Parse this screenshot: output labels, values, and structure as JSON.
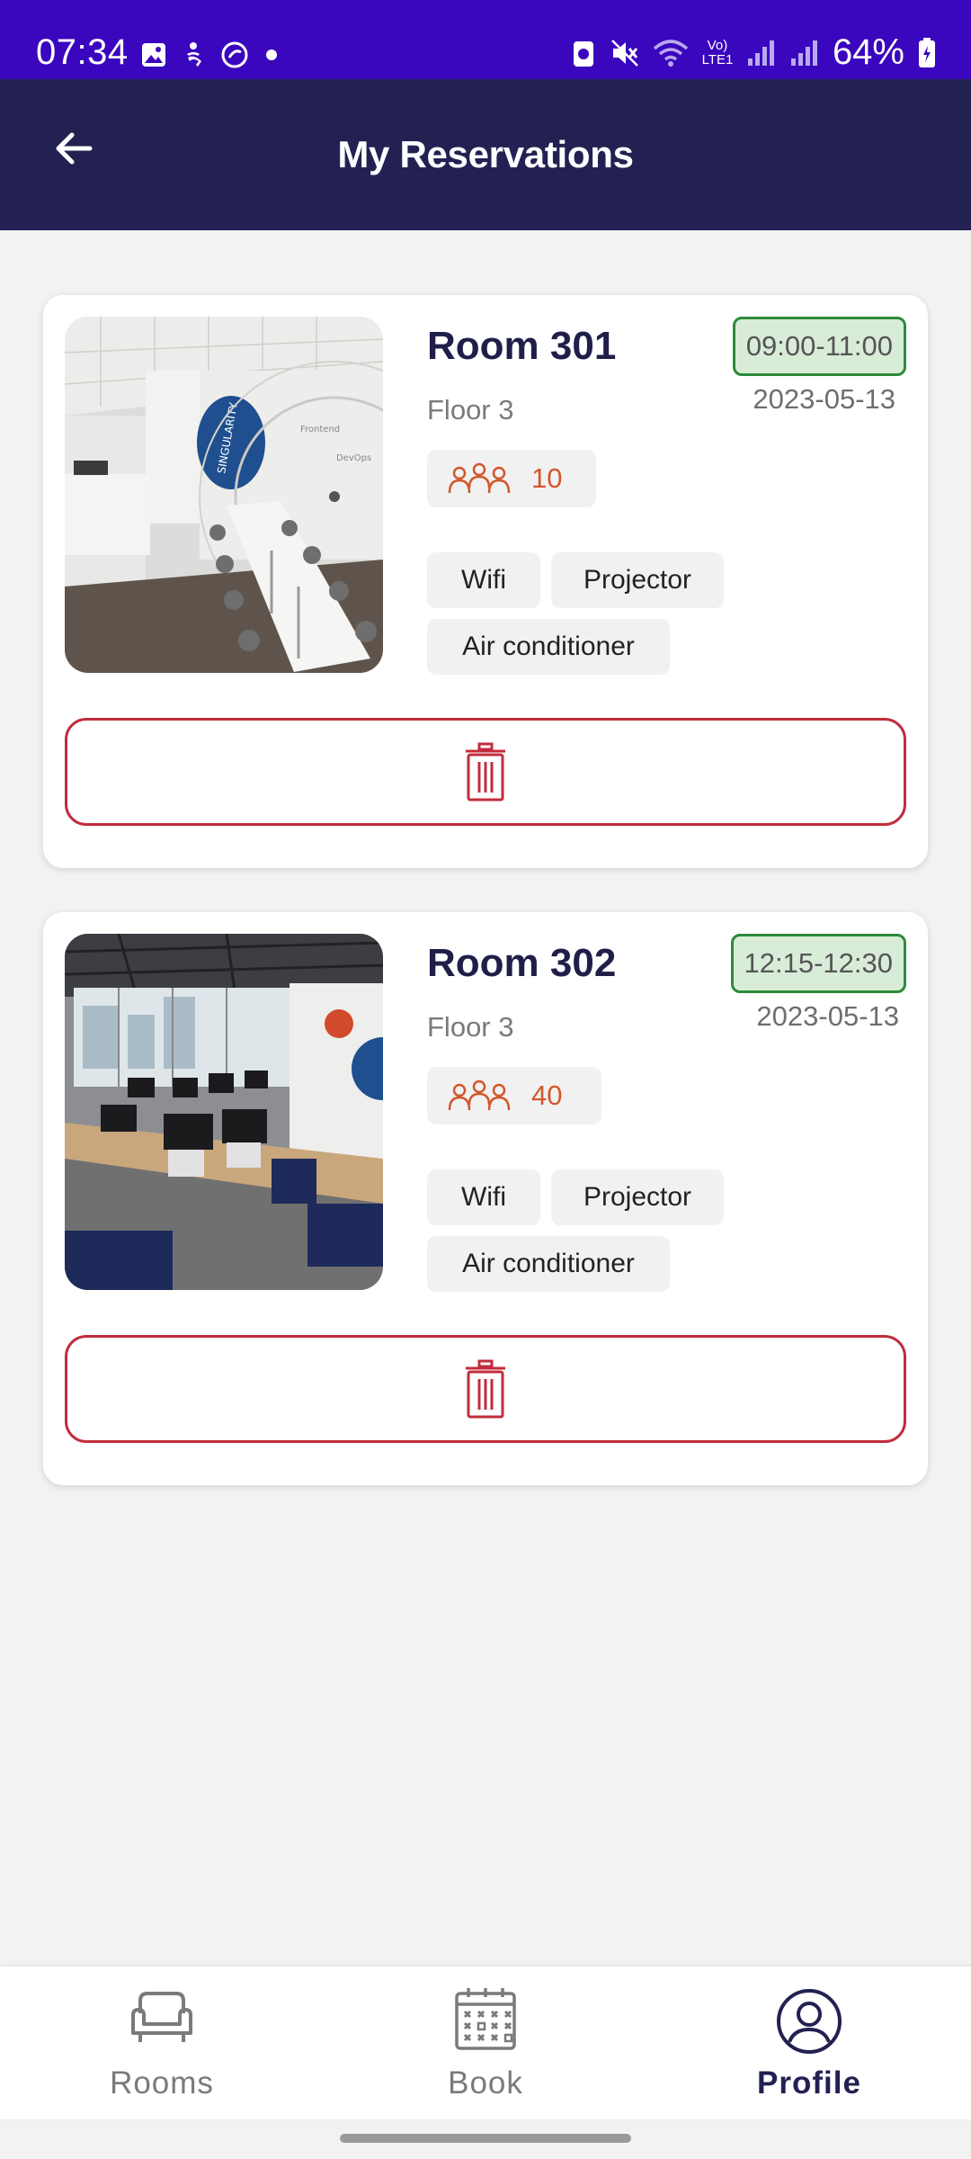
{
  "status_bar": {
    "time": "07:34",
    "battery": "64%",
    "network_label": "Vo) LTE1",
    "icons": [
      "image-icon",
      "accessibility-icon",
      "sync-icon",
      "dot-icon",
      "nfc-icon",
      "mute-icon",
      "wifi-icon",
      "signal-icon",
      "battery-icon"
    ]
  },
  "header": {
    "title": "My Reservations",
    "back_icon": "arrow-left-icon"
  },
  "reservations": [
    {
      "room_name": "Room 301",
      "floor": "Floor 3",
      "capacity": "10",
      "time": "09:00-11:00",
      "date": "2023-05-13",
      "amenities": [
        "Wifi",
        "Projector",
        "Air conditioner"
      ],
      "delete_icon": "trash-icon"
    },
    {
      "room_name": "Room 302",
      "floor": "Floor 3",
      "capacity": "40",
      "time": "12:15-12:30",
      "date": "2023-05-13",
      "amenities": [
        "Wifi",
        "Projector",
        "Air conditioner"
      ],
      "delete_icon": "trash-icon"
    }
  ],
  "bottom_nav": {
    "items": [
      {
        "label": "Rooms",
        "icon": "armchair-icon",
        "active": false
      },
      {
        "label": "Book",
        "icon": "calendar-icon",
        "active": false
      },
      {
        "label": "Profile",
        "icon": "user-circle-icon",
        "active": true
      }
    ]
  },
  "colors": {
    "status_bar": "#3a06be",
    "app_bar": "#222152",
    "time_badge_border": "#2d8a3a",
    "time_badge_bg": "#d9ecd8",
    "capacity": "#d2572b",
    "delete": "#c12d3c",
    "background": "#f2f2f3"
  }
}
